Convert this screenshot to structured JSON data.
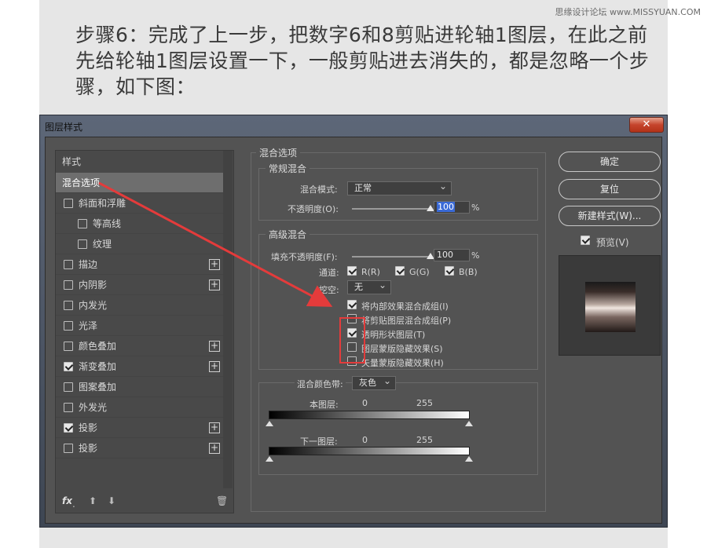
{
  "watermark": "思缘设计论坛 www.MISSYUAN.COM",
  "instruction": "步骤6：完成了上一步，把数字6和8剪贴进轮轴1图层，在此之前先给轮轴1图层设置一下，一般剪贴进去消失的，都是忽略一个步骤，如下图：",
  "window": {
    "title": "图层样式",
    "close": "✕"
  },
  "styles": {
    "header": "样式",
    "items": [
      {
        "label": "混合选项",
        "checkbox": false,
        "checked": false,
        "plus": false,
        "selected": true,
        "indent": 0
      },
      {
        "label": "斜面和浮雕",
        "checkbox": true,
        "checked": false,
        "plus": false,
        "selected": false,
        "indent": 0
      },
      {
        "label": "等高线",
        "checkbox": true,
        "checked": false,
        "plus": false,
        "selected": false,
        "indent": 1
      },
      {
        "label": "纹理",
        "checkbox": true,
        "checked": false,
        "plus": false,
        "selected": false,
        "indent": 1
      },
      {
        "label": "描边",
        "checkbox": true,
        "checked": false,
        "plus": true,
        "selected": false,
        "indent": 0
      },
      {
        "label": "内阴影",
        "checkbox": true,
        "checked": false,
        "plus": true,
        "selected": false,
        "indent": 0
      },
      {
        "label": "内发光",
        "checkbox": true,
        "checked": false,
        "plus": false,
        "selected": false,
        "indent": 0
      },
      {
        "label": "光泽",
        "checkbox": true,
        "checked": false,
        "plus": false,
        "selected": false,
        "indent": 0
      },
      {
        "label": "颜色叠加",
        "checkbox": true,
        "checked": false,
        "plus": true,
        "selected": false,
        "indent": 0
      },
      {
        "label": "渐变叠加",
        "checkbox": true,
        "checked": true,
        "plus": true,
        "selected": false,
        "indent": 0
      },
      {
        "label": "图案叠加",
        "checkbox": true,
        "checked": false,
        "plus": false,
        "selected": false,
        "indent": 0
      },
      {
        "label": "外发光",
        "checkbox": true,
        "checked": false,
        "plus": false,
        "selected": false,
        "indent": 0
      },
      {
        "label": "投影",
        "checkbox": true,
        "checked": true,
        "plus": true,
        "selected": false,
        "indent": 0
      },
      {
        "label": "投影",
        "checkbox": true,
        "checked": false,
        "plus": true,
        "selected": false,
        "indent": 0
      }
    ],
    "fx": "fx",
    "fx_dot": ".",
    "up": "⬆",
    "down": "⬇",
    "trash": "🗑"
  },
  "blending": {
    "title": "混合选项",
    "general": {
      "title": "常规混合",
      "mode_label": "混合模式:",
      "mode_value": "正常",
      "opacity_label": "不透明度(O):",
      "opacity_value": "100",
      "opacity_unit": "%",
      "opacity_fraction": 1.0
    },
    "advanced": {
      "title": "高级混合",
      "fill_label": "填充不透明度(F):",
      "fill_value": "100",
      "fill_unit": "%",
      "fill_fraction": 1.0,
      "channels_label": "通道:",
      "channels": [
        {
          "label": "R(R)",
          "checked": true
        },
        {
          "label": "G(G)",
          "checked": true
        },
        {
          "label": "B(B)",
          "checked": true
        }
      ],
      "knockout_label": "挖空:",
      "knockout_value": "无",
      "options": [
        {
          "label": "将内部效果混合成组(I)",
          "checked": true
        },
        {
          "label": "将剪贴图层混合成组(P)",
          "checked": false
        },
        {
          "label": "透明形状图层(T)",
          "checked": true
        },
        {
          "label": "图层蒙版隐藏效果(S)",
          "checked": false
        },
        {
          "label": "矢量蒙版隐藏效果(H)",
          "checked": false
        }
      ]
    },
    "blend_if": {
      "label": "混合颜色带:",
      "value": "灰色",
      "this_layer": "本图层:",
      "this_min": "0",
      "this_max": "255",
      "under_layer": "下一图层:",
      "under_min": "0",
      "under_max": "255"
    }
  },
  "buttons": {
    "ok": "确定",
    "reset": "复位",
    "new_style": "新建样式(W)...",
    "preview_label": "预览(V)",
    "preview_checked": true
  },
  "colors": {
    "annotation": "#e43b3b",
    "selection": "#3a6ad6"
  }
}
